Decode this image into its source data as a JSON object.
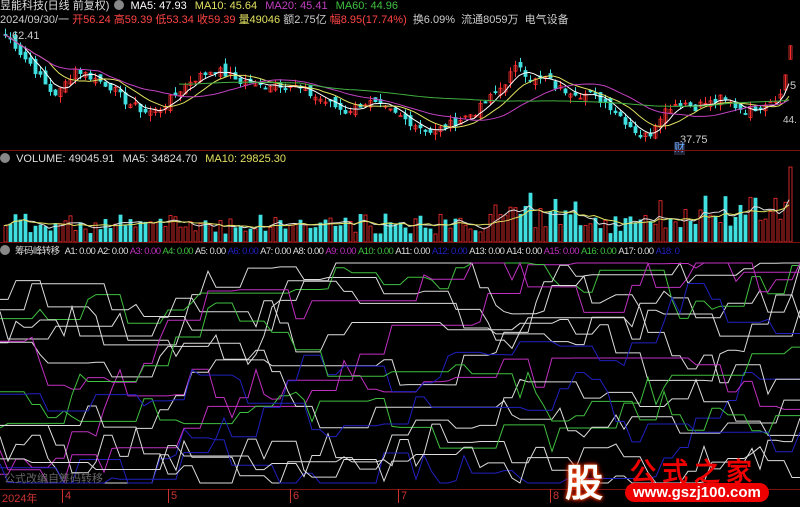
{
  "header": {
    "stock_name": "昱能科技(日线 前复权)",
    "ma5": "MA5: 47.93",
    "ma10": "MA10: 45.64",
    "ma20": "MA20: 45.41",
    "ma60": "MA60: 44.96"
  },
  "quote": {
    "date": "2024/09/30/一",
    "open": "开56.24",
    "high": "高59.39",
    "low": "低53.34",
    "close": "收59.39",
    "volume": "量49046",
    "amount": "额2.75亿",
    "change": "幅8.95(17.74%)",
    "turnover": "换6.09%",
    "float": "流通8059万",
    "sector": "电气设备"
  },
  "price": {
    "high_label": "62.41",
    "low_label": "37.75",
    "right_label_1": "5",
    "right_label_2": "44.",
    "marker_low": "财",
    "closes": [
      62,
      60,
      57,
      55,
      52,
      49,
      48,
      51,
      54,
      53,
      52,
      51,
      50,
      48,
      46,
      45,
      44,
      44,
      45,
      47,
      49,
      51,
      52,
      53,
      54,
      53,
      52,
      51,
      51,
      50,
      50,
      51,
      50,
      50,
      49,
      48,
      47,
      46,
      45,
      44,
      45,
      46,
      46,
      45,
      44,
      43,
      42,
      41,
      40,
      39,
      40,
      41,
      42,
      43,
      44,
      46,
      48,
      50,
      53,
      55,
      52,
      51,
      52,
      50,
      49,
      49,
      48,
      48,
      47,
      46,
      44,
      42,
      40,
      38,
      39,
      43,
      45,
      46,
      46,
      45,
      46,
      46,
      47,
      46,
      45,
      44,
      45,
      46,
      47,
      48,
      59
    ]
  },
  "volume_pane": {
    "label": "VOLUME: 49045.91",
    "ma5": "MA5: 34824.70",
    "ma10": "MA10: 29825.30"
  },
  "indicator": {
    "name": "筹码峰转移",
    "values": [
      {
        "label": "A1: 0.00",
        "color": "#dddddd"
      },
      {
        "label": "A2: 0.00",
        "color": "#dddddd"
      },
      {
        "label": "A3: 0.00",
        "color": "#c030c0"
      },
      {
        "label": "A4: 0.00",
        "color": "#40c040"
      },
      {
        "label": "A5: 0.00",
        "color": "#dddddd"
      },
      {
        "label": "A6: 0.00",
        "color": "#2020c0"
      },
      {
        "label": "A7: 0.00",
        "color": "#dddddd"
      },
      {
        "label": "A8: 0.00",
        "color": "#dddddd"
      },
      {
        "label": "A9: 0.00",
        "color": "#c030c0"
      },
      {
        "label": "A10: 0.00",
        "color": "#40c040"
      },
      {
        "label": "A11: 0.00",
        "color": "#dddddd"
      },
      {
        "label": "A12: 0.00",
        "color": "#2020c0"
      },
      {
        "label": "A13: 0.00",
        "color": "#dddddd"
      },
      {
        "label": "A14: 0.00",
        "color": "#dddddd"
      },
      {
        "label": "A15: 0.00",
        "color": "#c030c0"
      },
      {
        "label": "A16: 0.00",
        "color": "#40c040"
      },
      {
        "label": "A17: 0.00",
        "color": "#dddddd"
      },
      {
        "label": "A18: 0",
        "color": "#2020c0"
      }
    ],
    "footer_note": "公式改编自筹码转移"
  },
  "xaxis": {
    "year": "2024年",
    "months": [
      "4",
      "5",
      "6",
      "7",
      "8"
    ]
  },
  "watermark": {
    "glyph": "股",
    "title": "公式之家",
    "url": "www.gszj100.com"
  },
  "colors": {
    "up": "#ff3030",
    "down": "#40e0e0",
    "ma5": "#ffffff",
    "ma10": "#e0e060",
    "ma20": "#c040c0",
    "ma60": "#40b040"
  }
}
